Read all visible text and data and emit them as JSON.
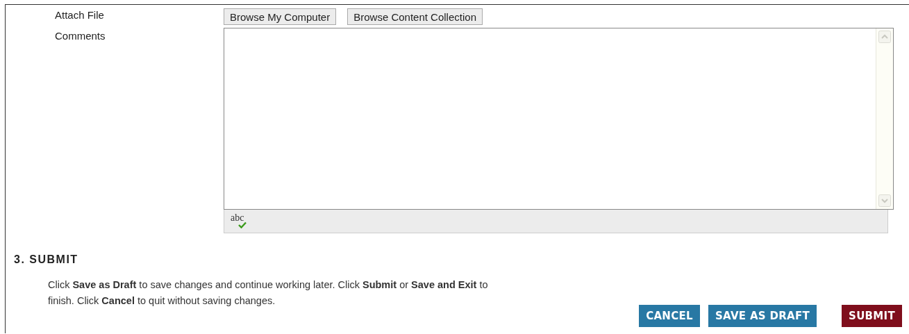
{
  "attach_file": {
    "label": "Attach File",
    "buttons": [
      "Browse My Computer",
      "Browse Content Collection"
    ]
  },
  "comments": {
    "label": "Comments",
    "spellcheck_label": "abc"
  },
  "section": {
    "heading": "3. SUBMIT",
    "instructions": "Click **Save as Draft** to save changes and continue working later. Click **Submit** or **Save and Exit** to finish. Click **Cancel** to quit without saving changes."
  },
  "actions": [
    {
      "label": "CANCEL",
      "kind": "secondary"
    },
    {
      "label": "SAVE AS DRAFT",
      "kind": "secondary"
    },
    {
      "label": "SUBMIT",
      "kind": "primary"
    }
  ]
}
